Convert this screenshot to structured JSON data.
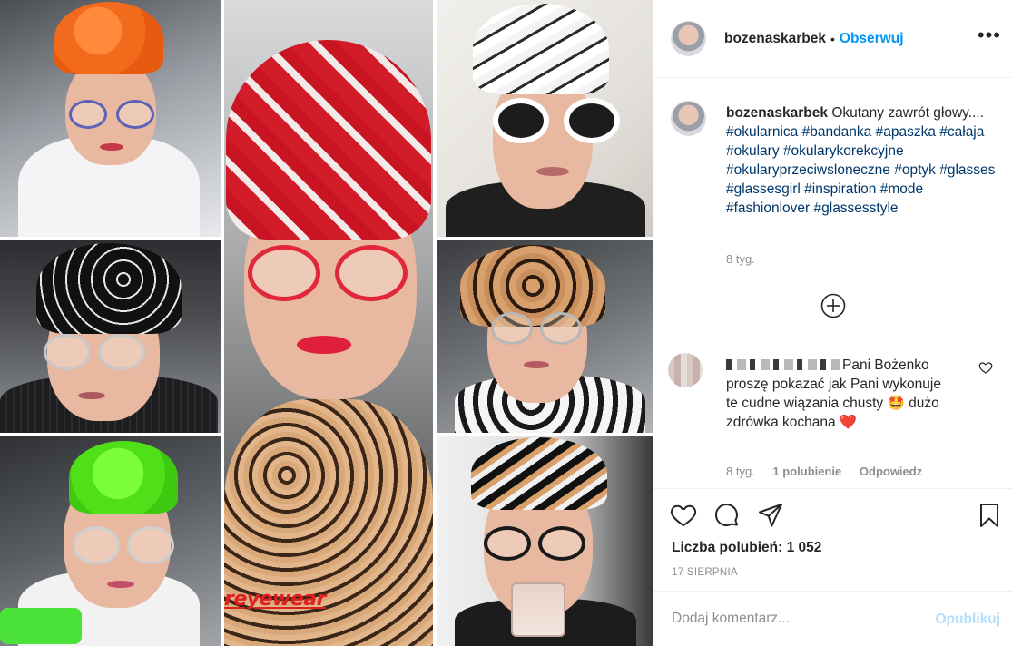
{
  "post": {
    "username": "bozenaskarbek",
    "dot": "•",
    "follow_label": "Obserwuj",
    "more_label": "•••",
    "watermark": "reyewear"
  },
  "caption": {
    "username": "bozenaskarbek",
    "text": "Okutany zawrót głowy....",
    "hashtags": "#okularnica #bandanka #apaszka #całaja #okulary #okularykorekcyjne #okularyprzeciwsloneczne #optyk #glasses #glassesgirl #inspiration #mode #fashionlover #glassesstyle",
    "time": "8 tyg."
  },
  "comment": {
    "text": "Pani Bożenko proszę pokazać jak Pani wykonuje te cudne wiązania chusty 🤩 dużo zdrówka kochana ❤️",
    "time": "8 tyg.",
    "likes": "1 polubienie",
    "reply_label": "Odpowiedz"
  },
  "actions": {
    "likes_text": "Liczba polubień: 1 052",
    "date": "17 SIERPNIA"
  },
  "add_comment": {
    "placeholder": "Dodaj komentarz...",
    "post_label": "Opublikuj"
  },
  "colors": {
    "accent": "#0095f6",
    "post_disabled": "#b2dffc",
    "muted": "#8e8e8e",
    "hashtag": "#00376b"
  },
  "icons": [
    "more-options-icon",
    "load-more-icon",
    "comment-heart-icon",
    "like-heart-icon",
    "comment-bubble-icon",
    "share-icon",
    "bookmark-icon"
  ]
}
